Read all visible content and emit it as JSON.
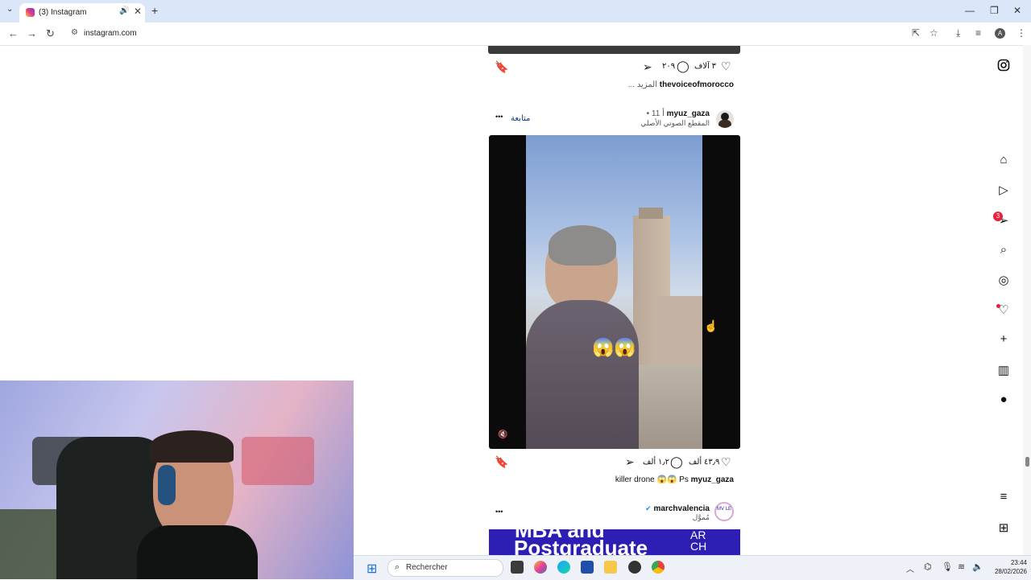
{
  "browser": {
    "tab_title": "(3) Instagram",
    "tab_audio_icon": "🔊",
    "tab_close": "✕",
    "new_tab": "+",
    "url": "instagram.com",
    "profile_initial": "A",
    "window_minimize": "—",
    "window_restore": "❐",
    "window_close": "✕"
  },
  "feed": {
    "post1": {
      "likes": "٣ آلاف",
      "comments": "٢٠٩",
      "username": "thevoiceofmorocco",
      "more": "... المزيد"
    },
    "post2": {
      "username": "myuz_gaza",
      "time": "• 11 أ",
      "audio": "المقطع الصوتي الأصلي",
      "follow": "متابعة",
      "more_menu": "•••",
      "emoji_overlay": "😱😱",
      "mute_icon": "🔇",
      "likes": "٤٣٫٩ ألف",
      "comments": "١٫٢ ألف",
      "caption_user": "myuz_gaza",
      "caption_text": "killer drone 😱😱 Ps"
    },
    "post3": {
      "username": "marchvalencia",
      "sponsored": "مُموَّل",
      "more_menu": "•••",
      "ad_line1": "MBA and",
      "ad_line2": "Postgraduate",
      "ad_side": "AR CH",
      "avatar_text": "MV LE"
    }
  },
  "sidebar": {
    "notification_count": "3"
  },
  "taskbar": {
    "search_placeholder": "Rechercher",
    "time": "23:44",
    "date": "28/02/2026"
  },
  "colors": {
    "instagram_blue": "#0f3a8a",
    "badge_red": "#e8203a",
    "ad_blue": "#2d1fb3",
    "titlebar": "#dbe7f8"
  }
}
